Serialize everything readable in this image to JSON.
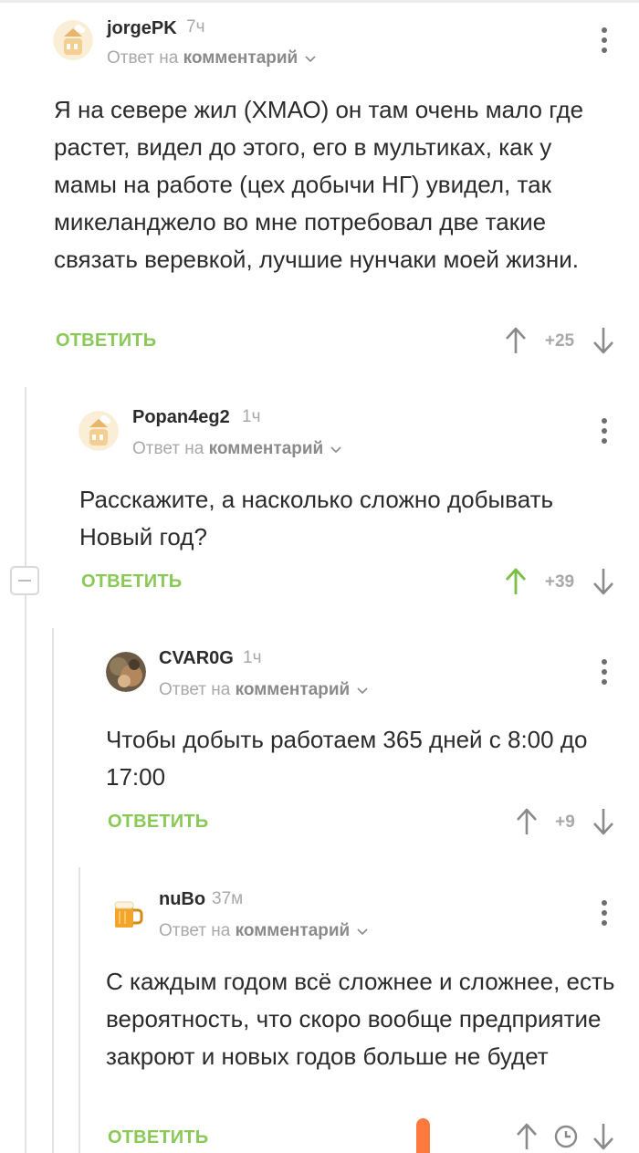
{
  "ui": {
    "reply_prefix": "Ответ на",
    "reply_target": "комментарий",
    "reply_action": "ОТВЕТИТЬ"
  },
  "comments": [
    {
      "author": "jorgePK",
      "time": "7ч",
      "text": "Я на севере жил (ХМАО) он там очень мало где растет, видел до этого, его в мультиках, как у мамы на работе (цех добычи НГ) увидел, так микеланджело во мне потребовал две такие связать веревкой, лучшие нунчаки моей жизни.",
      "rating": "+25",
      "avatar": "pikabu-default-avatar",
      "upvoted": false
    },
    {
      "author": "Popan4eg2",
      "time": "1ч",
      "text": "Расскажите, а насколько сложно добывать Новый год?",
      "rating": "+39",
      "avatar": "pikabu-default-avatar",
      "upvoted": true
    },
    {
      "author": "CVAR0G",
      "time": "1ч",
      "text": "Чтобы добыть работаем 365 дней с 8:00 до 17:00",
      "rating": "+9",
      "avatar": "photo-avatar",
      "upvoted": false
    },
    {
      "author": "nuBo",
      "time": "37м",
      "text": "С каждым годом всё сложнее и сложнее, есть вероятность, что скоро вообще предприятие закроют и новых годов больше не будет",
      "rating": "",
      "avatar": "beer-mug-avatar",
      "upvoted": false,
      "rating_hidden_icon": "clock-icon"
    }
  ],
  "colors": {
    "accent_green": "#8ac858",
    "muted": "#a8a8a8",
    "text": "#2b2b2b"
  }
}
